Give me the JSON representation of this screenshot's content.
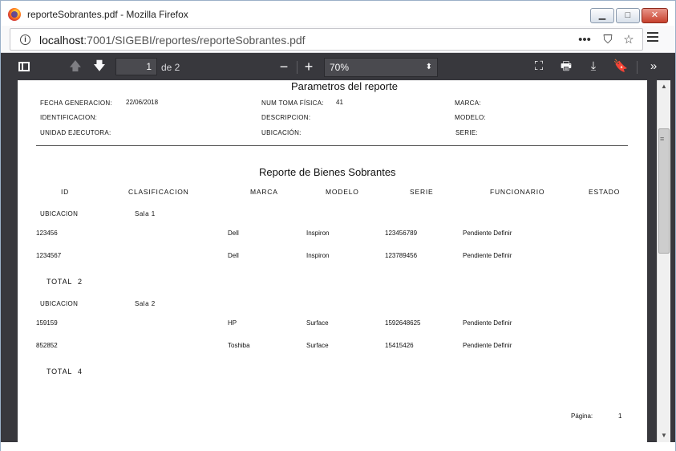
{
  "window": {
    "title": "reporteSobrantes.pdf - Mozilla Firefox",
    "minimize_label": "▁",
    "maximize_label": "□",
    "close_label": "✕"
  },
  "navbar": {
    "url_host": "localhost",
    "url_rest": ":7001/SIGEBI/reportes/reporteSobrantes.pdf",
    "actions": [
      "•••",
      "⛉",
      "☆"
    ]
  },
  "pdf_toolbar": {
    "page_current": "1",
    "page_of": "de 2",
    "zoom": "70%",
    "zoom_out_label": "−",
    "zoom_in_label": "+"
  },
  "report": {
    "params_title": "Parametros del reporte",
    "params": {
      "fecha_generacion_label": "FECHA GENERACION:",
      "fecha_generacion_value": "22/06/2018",
      "num_toma_label": "NUM TOMA FÍSICA:",
      "num_toma_value": "41",
      "marca_label": "MARCA:",
      "identificacion_label": "IDENTIFICACION:",
      "descripcion_label": "DESCRIPCION:",
      "modelo_label": "MODELO:",
      "unidad_label": "UNIDAD EJECUTORA:",
      "ubicacion_label": "UBICACIÓN:",
      "serie_label": "SERIE:"
    },
    "report_title": "Reporte de Bienes Sobrantes",
    "columns": [
      "ID",
      "CLASIFICACION",
      "MARCA",
      "MODELO",
      "SERIE",
      "FUNCIONARIO",
      "ESTADO"
    ],
    "groups": [
      {
        "location_label": "UBICACION",
        "location": "Sala 1",
        "rows": [
          {
            "id": "123456",
            "marca": "Dell",
            "modelo": "Inspiron",
            "serie": "123456789",
            "funcionario": "Pendiente Definir"
          },
          {
            "id": "1234567",
            "marca": "Dell",
            "modelo": "Inspiron",
            "serie": "123789456",
            "funcionario": "Pendiente Definir"
          }
        ],
        "total_label": "TOTAL",
        "total": "2"
      },
      {
        "location_label": "UBICACION",
        "location": "Sala 2",
        "rows": [
          {
            "id": "159159",
            "marca": "HP",
            "modelo": "Surface",
            "serie": "1592648625",
            "funcionario": "Pendiente Definir"
          },
          {
            "id": "852852",
            "marca": "Toshiba",
            "modelo": "Surface",
            "serie": "15415426",
            "funcionario": "Pendiente Definir"
          }
        ],
        "total_label": "TOTAL",
        "total": "4"
      }
    ],
    "page_label": "Página:",
    "page_number": "1"
  }
}
